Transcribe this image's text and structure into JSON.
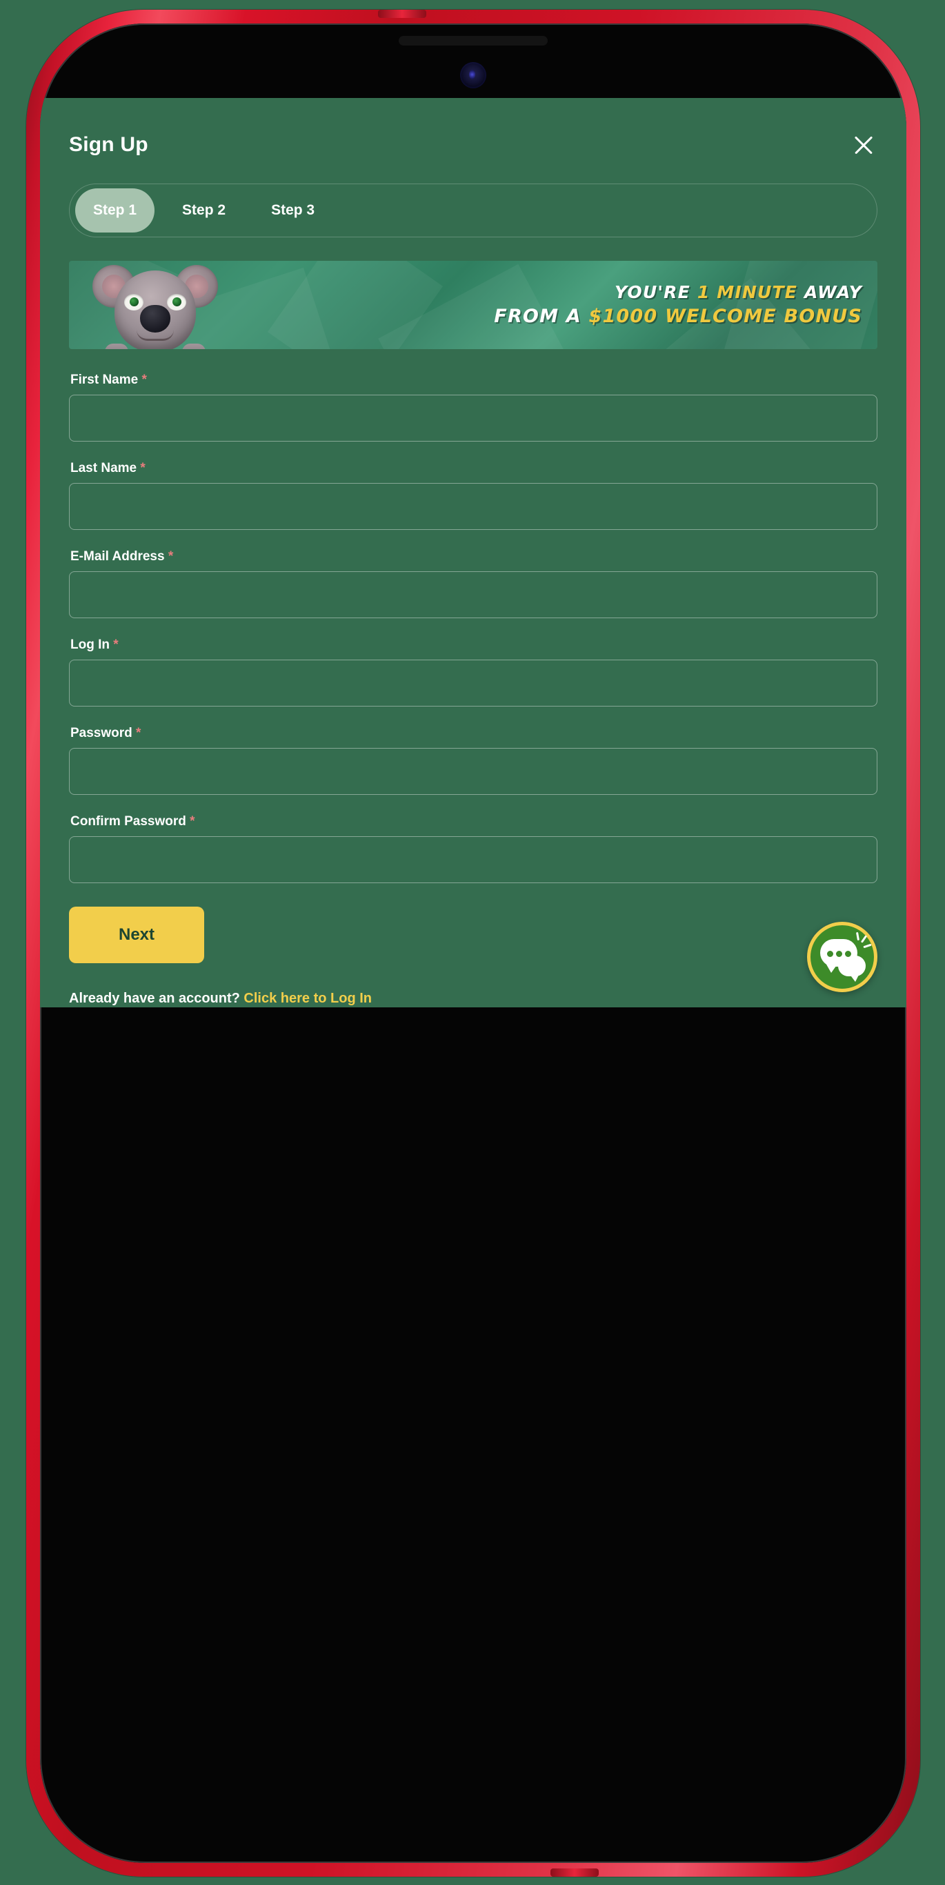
{
  "device": {
    "frame_color": "#d81228",
    "body_color": "#050505",
    "page_background": "#346d4f"
  },
  "modal": {
    "title": "Sign Up",
    "background_color": "#346d4f",
    "close_icon": "close-icon"
  },
  "steps": {
    "items": [
      {
        "label": "Step 1",
        "active": true
      },
      {
        "label": "Step 2",
        "active": false
      },
      {
        "label": "Step 3",
        "active": false
      }
    ],
    "active_pill_color": "#a6c3ae"
  },
  "promo_banner": {
    "line1_part1": "YOU'RE ",
    "line1_highlight": "1 MINUTE",
    "line1_part2": " AWAY",
    "line2_part1": "FROM A ",
    "line2_highlight": "$1000 WELCOME BONUS",
    "highlight_color": "#f0c93f",
    "mascot": "koala-mascot"
  },
  "form": {
    "fields": [
      {
        "label": "First Name",
        "required_mark": "*",
        "value": "",
        "placeholder": ""
      },
      {
        "label": "Last Name",
        "required_mark": "*",
        "value": "",
        "placeholder": ""
      },
      {
        "label": "E-Mail Address",
        "required_mark": "*",
        "value": "",
        "placeholder": ""
      },
      {
        "label": "Log In",
        "required_mark": "*",
        "value": "",
        "placeholder": ""
      },
      {
        "label": "Password",
        "required_mark": "*",
        "value": "",
        "placeholder": ""
      },
      {
        "label": "Confirm Password",
        "required_mark": "*",
        "value": "",
        "placeholder": ""
      }
    ],
    "required_color": "#e87d7d",
    "submit_label": "Next",
    "submit_color": "#f2ce4b"
  },
  "login_prompt": {
    "text": "Already have an account? ",
    "link_label": "Click here to Log In",
    "link_color": "#f2ce4b"
  },
  "chat_widget": {
    "icon": "chat-bubbles-icon",
    "circle_color": "#3d8b29",
    "ring_color": "#f2ce4b"
  }
}
